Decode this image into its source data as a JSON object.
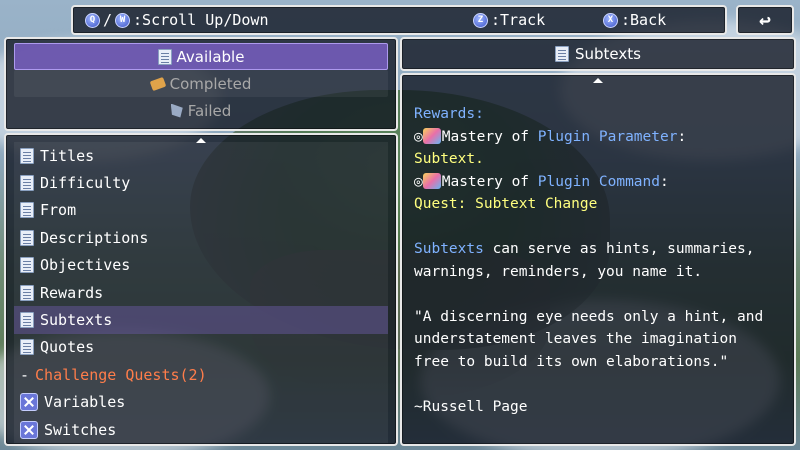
{
  "help_bar": {
    "scroll_key1": "Q",
    "scroll_sep": "/",
    "scroll_key2": "W",
    "scroll_label": ":Scroll Up/Down",
    "track_key": "Z",
    "track_label": ":Track",
    "back_key": "X",
    "back_label": ":Back"
  },
  "back_button": {
    "icon": "return-arrow-icon",
    "glyph": "↩"
  },
  "categories": [
    {
      "label": "Available",
      "icon": "document-icon"
    },
    {
      "label": "Completed",
      "icon": "ticket-icon"
    },
    {
      "label": "Failed",
      "icon": "failed-icon"
    }
  ],
  "quest_list": [
    {
      "label": "Titles",
      "icon": "document-icon"
    },
    {
      "label": "Difficulty",
      "icon": "document-icon"
    },
    {
      "label": "From",
      "icon": "document-icon"
    },
    {
      "label": "Descriptions",
      "icon": "document-icon"
    },
    {
      "label": "Objectives",
      "icon": "document-icon"
    },
    {
      "label": "Rewards",
      "icon": "document-icon"
    },
    {
      "label": "Subtexts",
      "icon": "document-icon"
    },
    {
      "label": "Quotes",
      "icon": "document-icon"
    },
    {
      "label": "Challenge Quests(2)",
      "prefix": "-",
      "icon": "none"
    },
    {
      "label": "Variables",
      "icon": "variables-icon"
    },
    {
      "label": "Switches",
      "icon": "switches-icon"
    }
  ],
  "detail_title": "Subtexts",
  "detail": {
    "rewards_heading": "Rewards:",
    "reward1_mark": "◎",
    "reward1_prefix": "Mastery of ",
    "reward1_highlight": "Plugin Parameter",
    "reward1_suffix": ":",
    "reward1_value": "Subtext.",
    "reward2_mark": "◎",
    "reward2_prefix": "Mastery of ",
    "reward2_highlight": "Plugin Command",
    "reward2_suffix": ":",
    "reward2_value": "Quest: Subtext Change",
    "subtext_highlight": "Subtexts",
    "subtext_line1_rest": " can serve as hints, summaries,",
    "subtext_line2": "warnings, reminders, you name it.",
    "quote_line1": "\"A discerning eye needs only a hint, and",
    "quote_line2": "understatement leaves the imagination",
    "quote_line3": "free to build its own elaborations.\"",
    "quote_author": "~Russell Page"
  },
  "colors": {
    "highlight_blue": "#7fb2ff",
    "value_yellow": "#ffff7f",
    "category_orange": "#ff7d4a",
    "selected_category": "#8264d2"
  }
}
